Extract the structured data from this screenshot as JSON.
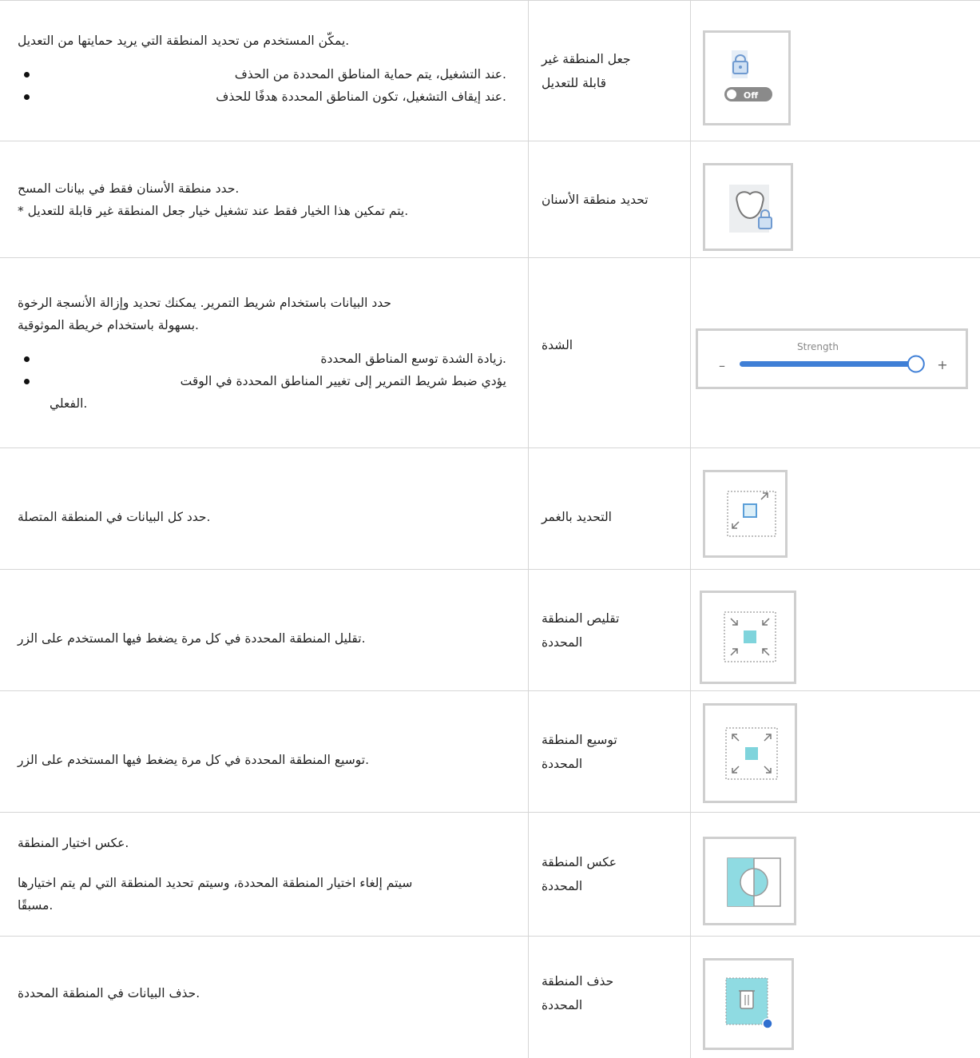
{
  "rows": [
    {
      "name": "جعل المنطقة غير قابلة للتعديل",
      "name_lines": [
        "جعل المنطقة غير",
        "قابلة للتعديل"
      ],
      "desc": ".يمكّن المستخدم من تحديد المنطقة التي يريد حمايتها من التعديل",
      "bullets": [
        ".عند التشغيل، يتم حماية المناطق المحددة من الحذف",
        ".عند إيقاف التشغيل، تكون المناطق المحددة هدفًا للحذف"
      ],
      "icon": "lock-toggle-icon",
      "icon_label": "Off"
    },
    {
      "name_lines": [
        "تحديد منطقة الأسنان"
      ],
      "desc_lines": [
        ".حدد منطقة الأسنان فقط في بيانات المسح",
        ".يتم تمكين هذا الخيار فقط عند تشغيل خيار جعل المنطقة غير قابلة للتعديل *"
      ],
      "icon": "tooth-lock-icon"
    },
    {
      "name_lines": [
        "الشدة"
      ],
      "desc_lines": [
        "حدد البيانات باستخدام شريط التمرير. يمكنك تحديد وإزالة الأنسجة الرخوة",
        ".بسهولة باستخدام خريطة الموثوقية"
      ],
      "bullets": [
        ".زيادة الشدة توسع المناطق المحددة",
        "يؤدي ضبط شريط التمرير إلى تغيير المناطق المحددة في الوقت",
        ".الفعلي"
      ],
      "icon": "strength-slider-icon",
      "slider_label": "Strength",
      "slider_minus": "–",
      "slider_plus": "+",
      "slider_value": 0.92
    },
    {
      "name_lines": [
        "التحديد بالغمر"
      ],
      "desc_lines": [
        ".حدد كل البيانات في المنطقة المتصلة"
      ],
      "icon": "flood-select-icon"
    },
    {
      "name_lines": [
        "تقليص المنطقة",
        "المحددة"
      ],
      "desc_lines": [
        ".تقليل المنطقة المحددة في كل مرة يضغط فيها المستخدم على الزر"
      ],
      "icon": "shrink-selection-icon"
    },
    {
      "name_lines": [
        "توسيع المنطقة",
        "المحددة"
      ],
      "desc_lines": [
        ".توسيع المنطقة المحددة في كل مرة يضغط فيها المستخدم على الزر"
      ],
      "icon": "expand-selection-icon"
    },
    {
      "name_lines": [
        "عكس المنطقة",
        "المحددة"
      ],
      "desc_lines": [
        ".عكس اختيار المنطقة",
        "سيتم إلغاء اختيار المنطقة المحددة، وسيتم تحديد المنطقة التي لم يتم اختيارها",
        ".مسبقًا"
      ],
      "icon": "invert-selection-icon"
    },
    {
      "name_lines": [
        "حذف المنطقة",
        "المحددة"
      ],
      "desc_lines": [
        ".حذف البيانات في المنطقة المحددة"
      ],
      "icon": "delete-selection-icon"
    }
  ]
}
